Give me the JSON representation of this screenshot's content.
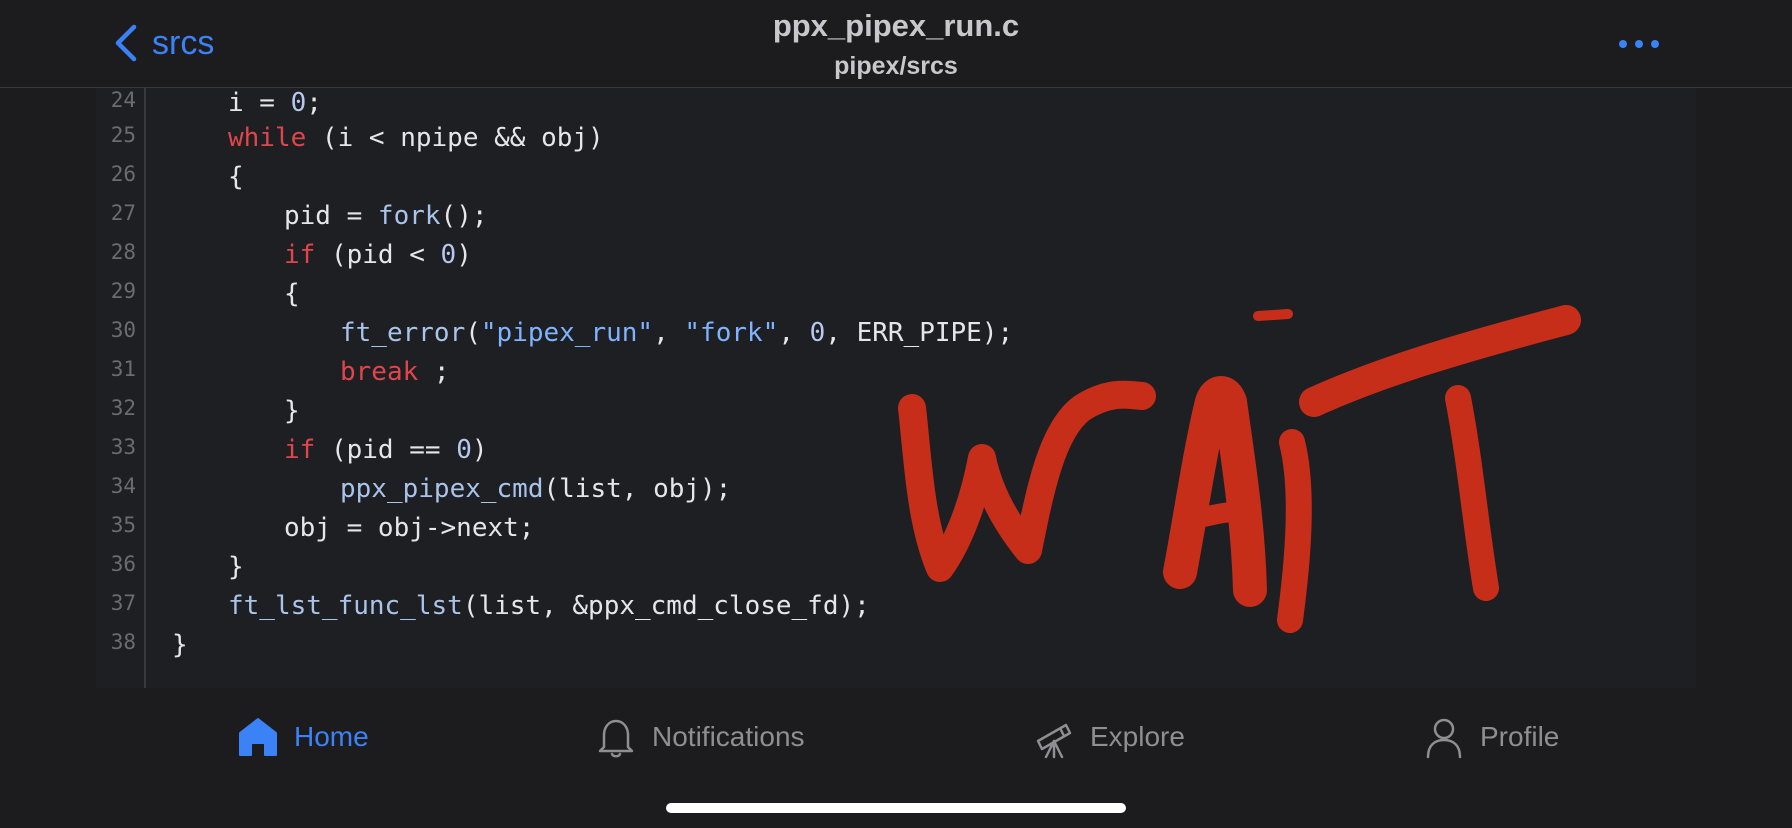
{
  "nav": {
    "back_label": "srcs",
    "title": "ppx_pipex_run.c",
    "subtitle": "pipex/srcs"
  },
  "code": {
    "lines": [
      {
        "n": "24"
      },
      {
        "n": "25"
      },
      {
        "n": "26"
      },
      {
        "n": "27"
      },
      {
        "n": "28"
      },
      {
        "n": "29"
      },
      {
        "n": "30"
      },
      {
        "n": "31"
      },
      {
        "n": "32"
      },
      {
        "n": "33"
      },
      {
        "n": "34"
      },
      {
        "n": "35"
      },
      {
        "n": "36"
      },
      {
        "n": "37"
      },
      {
        "n": "38"
      }
    ],
    "t": {
      "i_eq": "i = ",
      "zero": "0",
      "semi": ";",
      "while": "while",
      "while_cond": " (i < npipe && obj)",
      "lbrace": "{",
      "rbrace": "}",
      "pid_eq": "pid = ",
      "fork": "fork",
      "call_end": "();",
      "if": "if",
      "pid_lt": " (pid < ",
      "close_paren": ")",
      "ft_error": "ft_error",
      "open_paren": "(",
      "str_pipex_run": "\"pipex_run\"",
      "comma_sp": ", ",
      "str_fork": "\"fork\"",
      "err_tail": ", ERR_PIPE);",
      "break": "break",
      "space_semi": " ;",
      "pid_eqeq": " (pid == ",
      "ppx_pipex_cmd": "ppx_pipex_cmd",
      "cmd_args": "(list, obj);",
      "obj_next": "obj = obj->next;",
      "ft_lst_func_lst": "ft_lst_func_lst",
      "lst_args": "(list, &ppx_cmd_close_fd);"
    }
  },
  "overlay": {
    "handwritten_text": "WAiT",
    "color": "#d9301a"
  },
  "tabs": [
    {
      "label": "Home",
      "icon": "home-icon",
      "active": true
    },
    {
      "label": "Notifications",
      "icon": "bell-icon",
      "active": false
    },
    {
      "label": "Explore",
      "icon": "telescope-icon",
      "active": false
    },
    {
      "label": "Profile",
      "icon": "person-icon",
      "active": false
    }
  ],
  "colors": {
    "accent": "#3b82f6",
    "keyword": "#e0454b",
    "string": "#7fb2ff",
    "background": "#1c1c1e"
  }
}
